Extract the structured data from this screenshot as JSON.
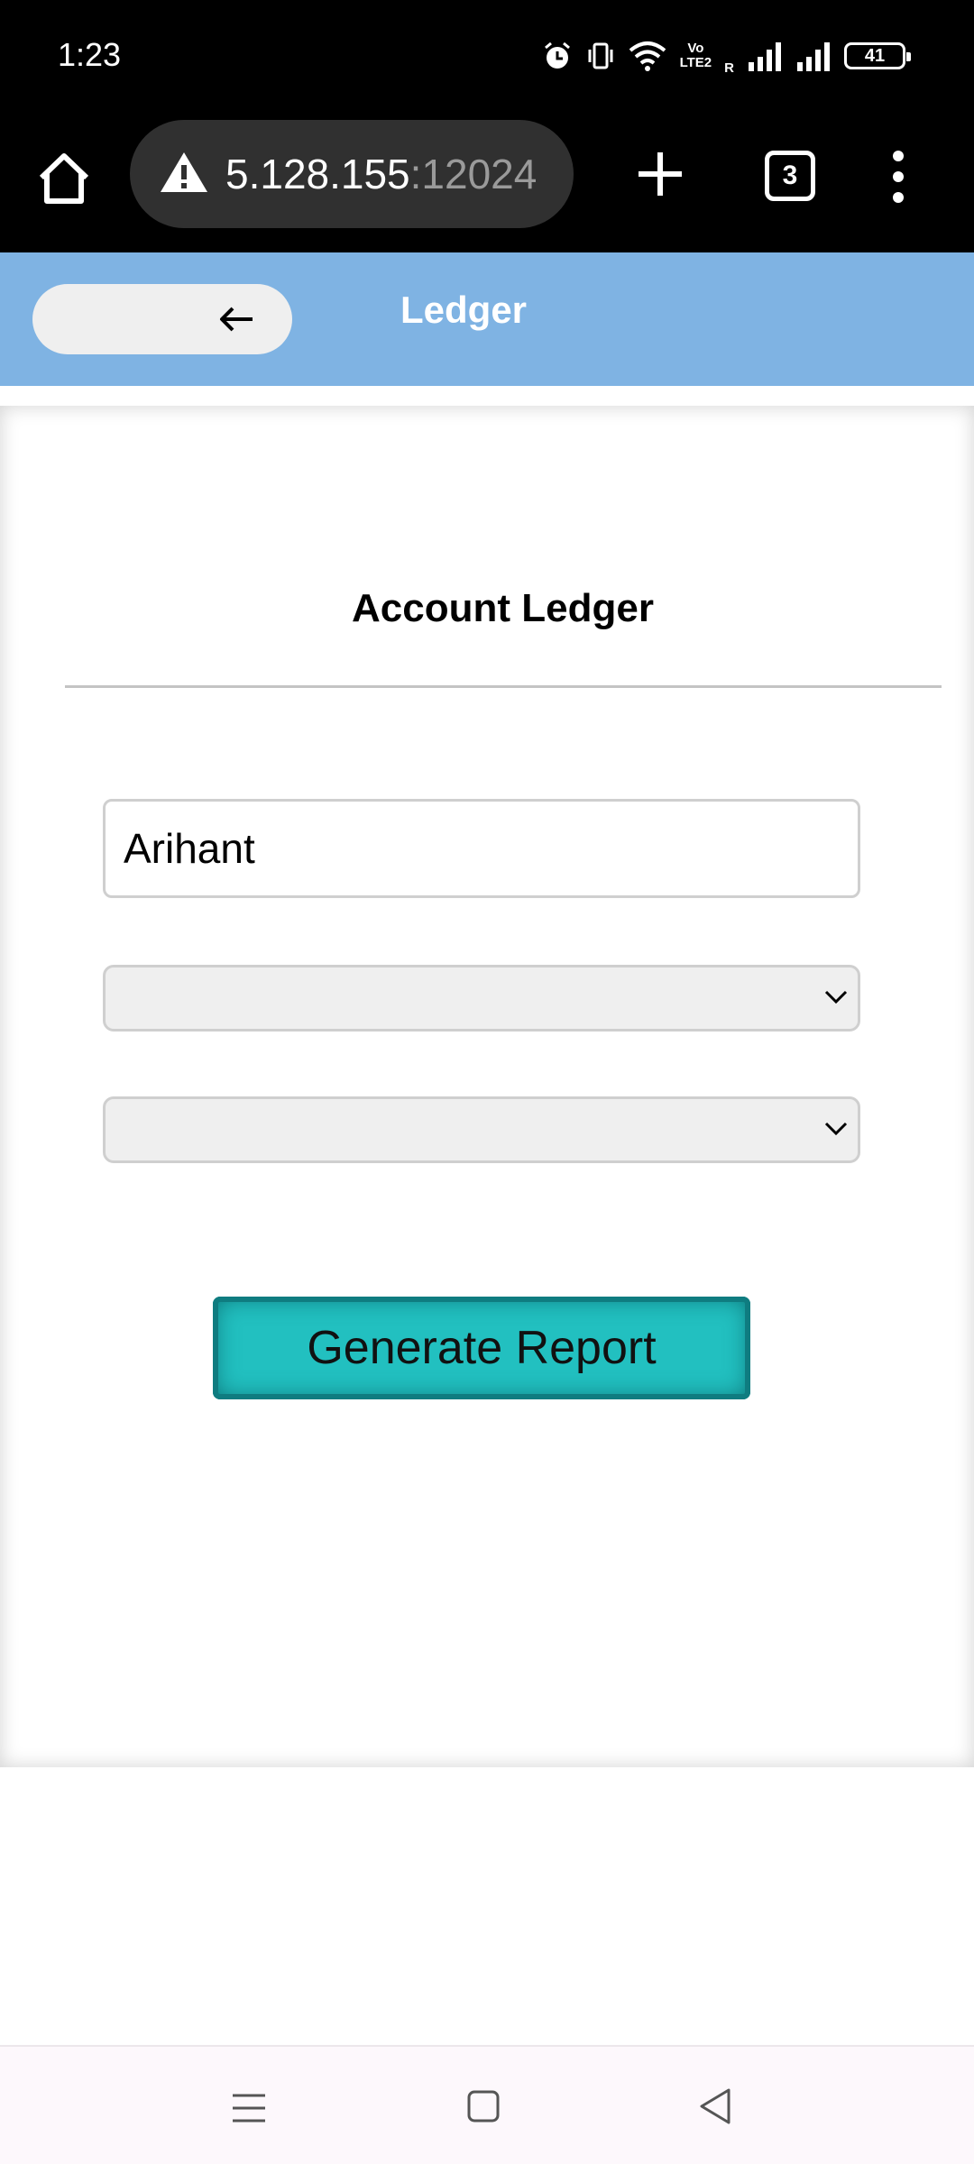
{
  "status_bar": {
    "time": "1:23",
    "volte_top": "Vo",
    "volte_bottom": "LTE2",
    "roaming": "R",
    "battery": "41",
    "icons": [
      "alarm-icon",
      "vibrate-icon",
      "wifi-icon",
      "volte-icon",
      "signal-icon",
      "signal-icon",
      "battery-icon"
    ]
  },
  "browser": {
    "url_host": "5.128.155",
    "url_port": ":12024",
    "tab_count": "3",
    "icons": [
      "home-icon",
      "warning-icon",
      "plus-icon",
      "more-vert-icon"
    ]
  },
  "header": {
    "title": "Ledger",
    "back_icon": "arrow-left-icon",
    "color": "#7fb3e3"
  },
  "form": {
    "title": "Account Ledger",
    "account_value": "Arihant",
    "select_1_value": "",
    "select_2_value": "",
    "generate_label": "Generate Report",
    "button_color": "#22c0c0"
  },
  "nav_bar": {
    "icons": [
      "recents-icon",
      "home-square-icon",
      "back-triangle-icon"
    ]
  }
}
